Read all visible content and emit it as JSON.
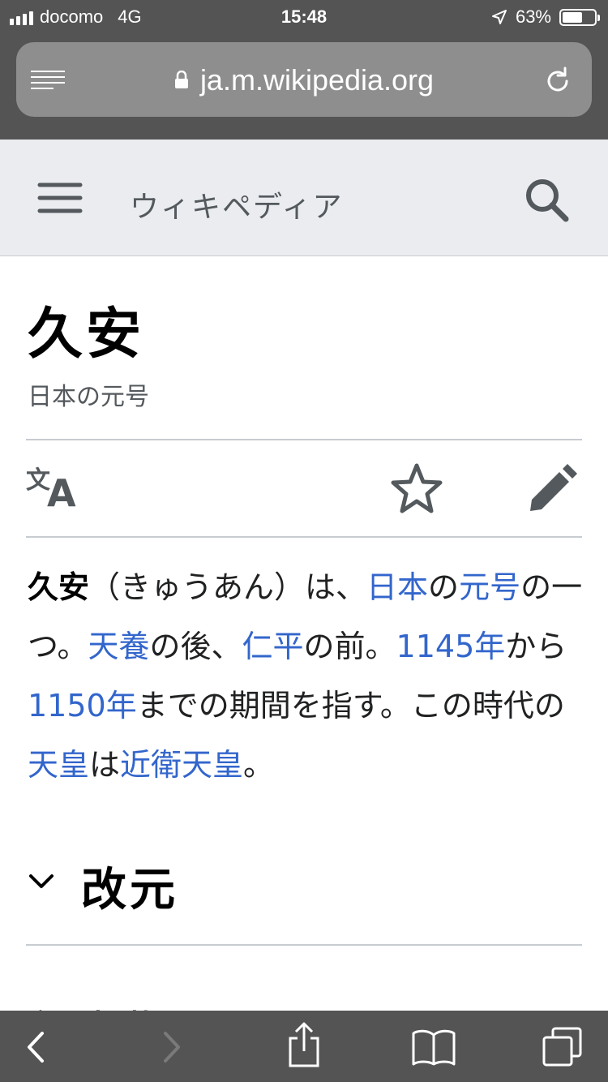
{
  "status_bar": {
    "carrier": "docomo",
    "network": "4G",
    "time": "15:48",
    "battery_percent": "63%",
    "battery_level": 0.63
  },
  "browser": {
    "url": "ja.m.wikipedia.org",
    "icons": [
      "reader-icon",
      "lock-icon",
      "reload-icon"
    ]
  },
  "header": {
    "brand": "ウィキペディア",
    "icons": [
      "menu-icon",
      "search-icon"
    ]
  },
  "article": {
    "title": "久安",
    "subtitle": "日本の元号",
    "actions": [
      "language-icon",
      "star-icon",
      "edit-icon"
    ],
    "lead": {
      "t1": "久安",
      "t2": "（きゅうあん）は、",
      "l1": "日本",
      "t3": "の",
      "l2": "元号",
      "t4": "の一つ。",
      "l3": "天養",
      "t5": "の後、",
      "l4": "仁平",
      "t6": "の前。",
      "l5": "1145年",
      "t7": "から",
      "l6": "1150年",
      "t8": "までの期間を指す。この時代の",
      "l7": "天皇",
      "t9": "は",
      "l8": "近衛天皇",
      "t10": "。"
    },
    "section_title": "改元",
    "next_heading": "年表指いるから"
  },
  "toolbar": {
    "icons": [
      "back-icon",
      "forward-icon",
      "share-icon",
      "bookmarks-icon",
      "tabs-icon"
    ]
  },
  "colors": {
    "chrome": "#545454",
    "address_bar": "#8e8e8e",
    "header_bg": "#eaecf0",
    "link": "#3366cc"
  }
}
